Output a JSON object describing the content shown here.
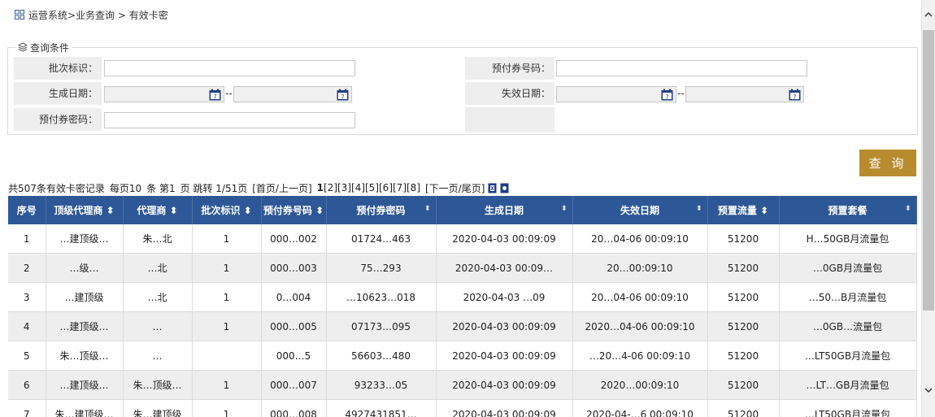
{
  "breadcrumb": {
    "text": "运营系统>业务查询 > 有效卡密"
  },
  "search": {
    "legend": "查询条件",
    "batch_label": "批次标识：",
    "batch_value": "",
    "voucher_no_label": "预付券号码：",
    "voucher_no_value": "",
    "created_label": "生成日期：",
    "created_from": "",
    "created_to": "",
    "expire_label": "失效日期：",
    "expire_from": "",
    "expire_to": "",
    "password_label": "预付券密码：",
    "password_value": "",
    "range_sep": "--",
    "query_button": "查 询"
  },
  "pager": {
    "summary": "共507条有效卡密记录",
    "per_page_prefix": "每页10",
    "per_page_suffix": "条 第1",
    "jump_text": "页 跳转 1/51页",
    "first_prev": "[首页/上一页]",
    "current": "1",
    "pages": [
      "[2]",
      "[3]",
      "[4]",
      "[5]",
      "[6]",
      "[7]",
      "[8]"
    ],
    "next_last": "[下一页/尾页]"
  },
  "table": {
    "columns": [
      "序号",
      "顶级代理商",
      "代理商",
      "批次标识",
      "预付券号码",
      "预付券密码",
      "生成日期",
      "失效日期",
      "预置流量",
      "预置套餐"
    ],
    "rows": [
      [
        "1",
        "…建顶级…",
        "朱…北",
        "1",
        "000…002",
        "01724…463",
        "2020-04-03 00:09:09",
        "20…04-06 00:09:10",
        "51200",
        "H…50GB月流量包"
      ],
      [
        "2",
        "…级…",
        "…北",
        "1",
        "000…003",
        "75…293",
        "2020-04-03 00:09…",
        "20…00:09:10",
        "51200",
        "…0GB月流量包"
      ],
      [
        "3",
        "…建顶级",
        "…北",
        "1",
        "0…004",
        "…10623…018",
        "2020-04-03 …09",
        "20…04-06 00:09:10",
        "51200",
        "…50…B月流量包"
      ],
      [
        "4",
        "…建顶级…",
        "…",
        "1",
        "000…005",
        "07173…095",
        "2020-04-03 00:09:09",
        "2020…04-06 00:09:10",
        "51200",
        "…0GB…流量包"
      ],
      [
        "5",
        "朱…顶级…",
        "…",
        "",
        "000…5",
        "56603…480",
        "2020-04-03 00:09:09",
        "…20…4-06 00:09:10",
        "51200",
        "…LT50GB月流量包"
      ],
      [
        "6",
        "…建顶级…",
        "朱…顶级…",
        "1",
        "000…007",
        "93233…05",
        "2020-04-03 00:09:09",
        "2020…00:09:10",
        "51200",
        "…LT…GB月流量包"
      ],
      [
        "7",
        "朱…建顶级…",
        "朱…建顶级",
        "1",
        "000…008",
        "4927431851…",
        "2020-04-03 00:09:09",
        "2020-04-…6 00:09:10",
        "51200",
        "…LT50GB月流量包"
      ]
    ]
  }
}
